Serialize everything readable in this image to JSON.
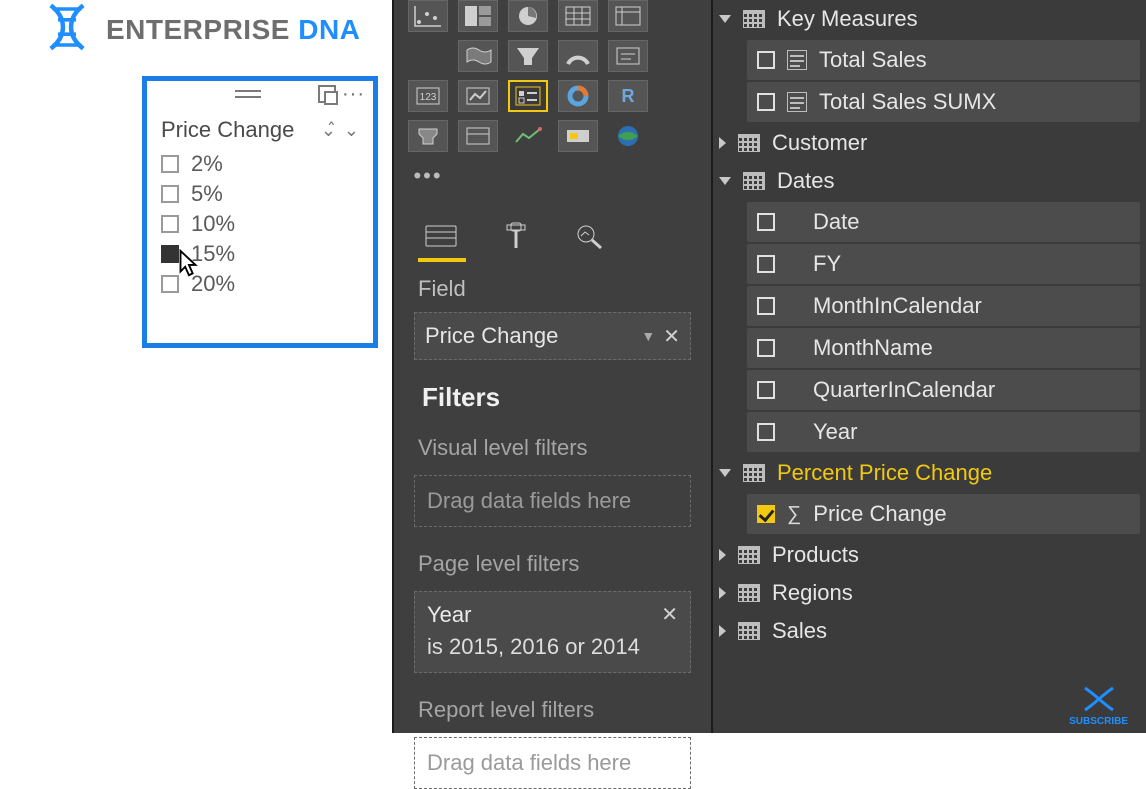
{
  "logo": {
    "word1": "ENTERPRISE",
    "word2": "DNA"
  },
  "slicer": {
    "title": "Price Change",
    "items": [
      "2%",
      "5%",
      "10%",
      "15%",
      "20%"
    ],
    "selected_index": 3
  },
  "viz": {
    "selected_icon": "slicer-visual-icon",
    "field_section_label": "Field",
    "field_well_value": "Price Change",
    "filters_heading": "Filters",
    "visual_filters_label": "Visual level filters",
    "page_filters_label": "Page level filters",
    "report_filters_label": "Report level filters",
    "drag_placeholder": "Drag data fields here",
    "page_filter": {
      "field": "Year",
      "summary": "is 2015, 2016 or 2014"
    }
  },
  "fields": {
    "key_measures": {
      "label": "Key Measures",
      "items": [
        "Total Sales",
        "Total Sales SUMX"
      ]
    },
    "customer": {
      "label": "Customer"
    },
    "dates": {
      "label": "Dates",
      "items": [
        "Date",
        "FY",
        "MonthInCalendar",
        "MonthName",
        "QuarterInCalendar",
        "Year"
      ]
    },
    "percent_price_change": {
      "label": "Percent Price Change",
      "items": [
        "Price Change"
      ],
      "checked": true
    },
    "products": {
      "label": "Products"
    },
    "regions": {
      "label": "Regions"
    },
    "sales": {
      "label": "Sales"
    }
  },
  "subscribe_label": "SUBSCRIBE"
}
